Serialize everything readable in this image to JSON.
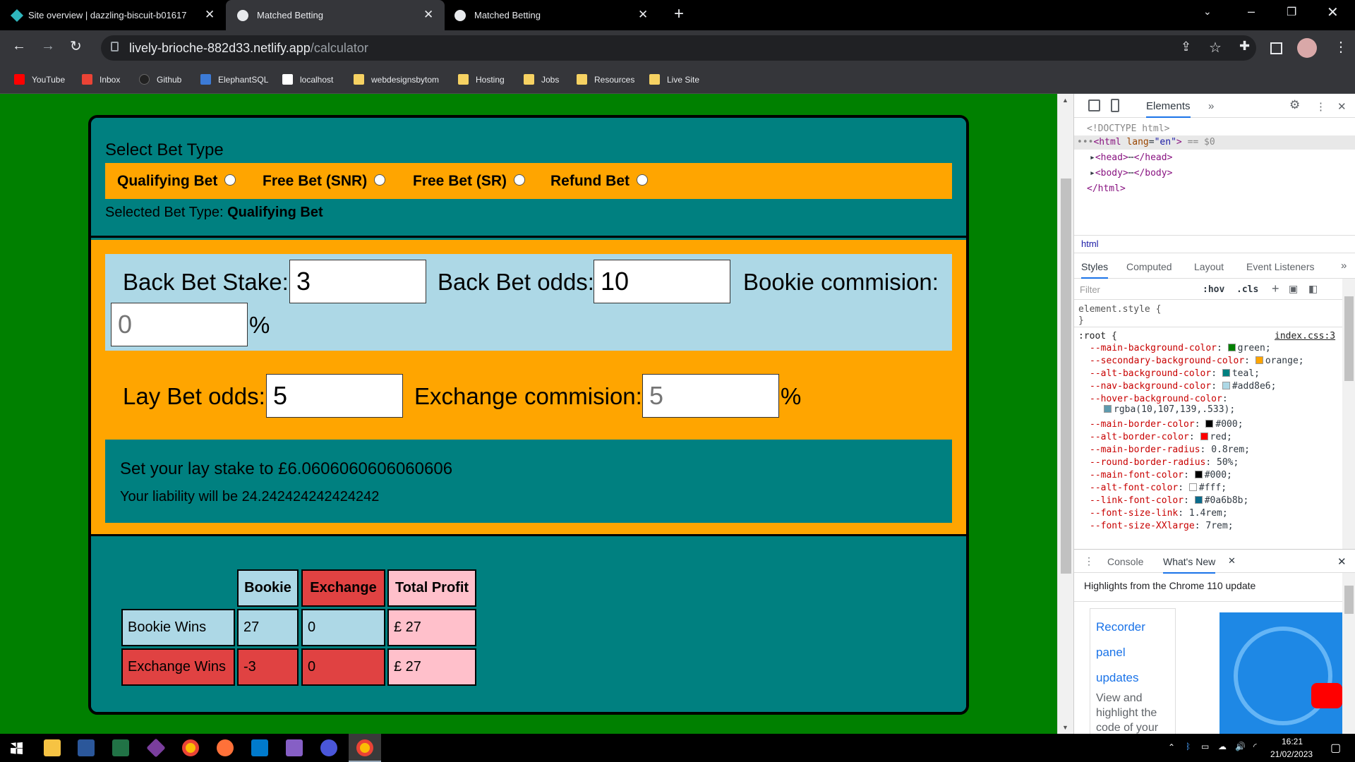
{
  "browser": {
    "tabs": [
      {
        "title": "Site overview | dazzling-biscuit-b01617",
        "active": false
      },
      {
        "title": "Matched Betting",
        "active": true
      },
      {
        "title": "Matched Betting",
        "active": false
      }
    ],
    "url_host": "lively-brioche-882d33.netlify.app",
    "url_path": "/calculator",
    "bookmarks": [
      "YouTube",
      "Inbox",
      "Github",
      "ElephantSQL",
      "localhost",
      "webdesignsbytom",
      "Hosting",
      "Jobs",
      "Resources",
      "Live Site"
    ]
  },
  "app": {
    "select_title": "Select Bet Type",
    "bet_types": [
      "Qualifying Bet",
      "Free Bet (SNR)",
      "Free Bet (SR)",
      "Refund Bet"
    ],
    "selected_prefix": "Selected Bet Type: ",
    "selected_value": "Qualifying Bet",
    "back_stake_label": "Back Bet Stake:",
    "back_stake_value": "3",
    "back_odds_label": "Back Bet odds:",
    "back_odds_value": "10",
    "bookie_comm_label": "Bookie commision:",
    "bookie_comm_value": "0",
    "percent": "%",
    "lay_odds_label": "Lay Bet odds:",
    "lay_odds_value": "5",
    "exchange_comm_label": "Exchange commision:",
    "exchange_comm_value": "5",
    "lay_stake_text": "Set your lay stake to £6.0606060606060606",
    "liability_text": "Your liability will be 24.242424242424242",
    "table": {
      "headers": [
        "Bookie",
        "Exchange",
        "Total Profit"
      ],
      "rows": [
        {
          "label": "Bookie Wins",
          "bookie": "27",
          "exchange": "0",
          "total": "£ 27"
        },
        {
          "label": "Exchange Wins",
          "bookie": "-3",
          "exchange": "0",
          "total": "£ 27"
        }
      ]
    }
  },
  "devtools": {
    "tabs": [
      "Elements"
    ],
    "doctype": "<!DOCTYPE html>",
    "breadcrumb": "html",
    "style_tabs": [
      "Styles",
      "Computed",
      "Layout",
      "Event Listeners"
    ],
    "filter_placeholder": "Filter",
    "hov": ":hov",
    "cls": ".cls",
    "element_style": "element.style {",
    "root_selector": ":root {",
    "source": "index.css:3",
    "vars": [
      {
        "name": "--main-background-color",
        "value": "green",
        "color": "#008000"
      },
      {
        "name": "--secondary-background-color",
        "value": "orange",
        "color": "#ffa500"
      },
      {
        "name": "--alt-background-color",
        "value": "teal",
        "color": "#008080"
      },
      {
        "name": "--nav-background-color",
        "value": "#add8e6",
        "color": "#add8e6"
      },
      {
        "name": "--hover-background-color",
        "value": "rgba(10,107,139,.533)",
        "color": "#5e9aae"
      },
      {
        "name": "--main-border-color",
        "value": "#000",
        "color": "#000000"
      },
      {
        "name": "--alt-border-color",
        "value": "red",
        "color": "#ff0000"
      },
      {
        "name": "--main-border-radius",
        "value": "0.8rem",
        "color": ""
      },
      {
        "name": "--round-border-radius",
        "value": "50%",
        "color": ""
      },
      {
        "name": "--main-font-color",
        "value": "#000",
        "color": "#000000"
      },
      {
        "name": "--alt-font-color",
        "value": "#fff",
        "color": "#ffffff"
      },
      {
        "name": "--link-font-color",
        "value": "#0a6b8b",
        "color": "#0a6b8b"
      },
      {
        "name": "--font-size-link",
        "value": "1.4rem",
        "color": ""
      },
      {
        "name": "--font-size-XXlarge",
        "value": "7rem",
        "color": ""
      }
    ],
    "drawer_tabs": [
      "Console",
      "What's New"
    ],
    "whats_new_title": "Highlights from the Chrome 110 update",
    "whats_new_links": [
      "Recorder",
      "panel",
      "updates"
    ],
    "whats_new_text": "View and highlight the code of your"
  },
  "taskbar": {
    "time": "16:21",
    "date": "21/02/2023"
  }
}
